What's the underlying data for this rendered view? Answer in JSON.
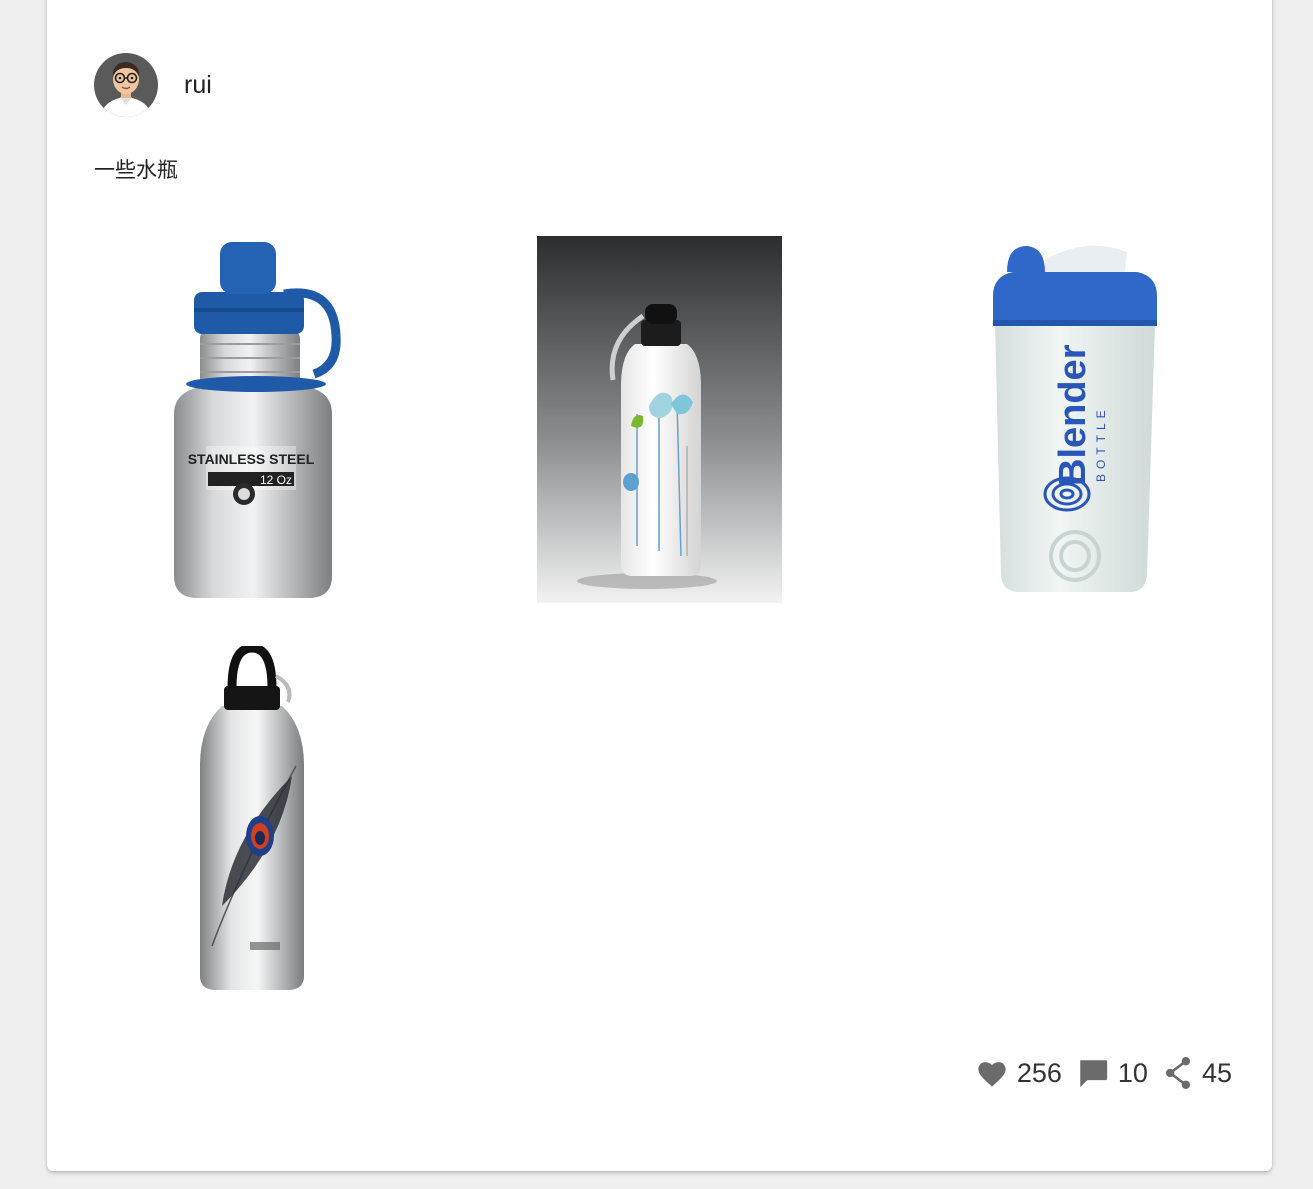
{
  "post": {
    "author": {
      "name": "rui",
      "avatar_icon": "cartoon-avatar-glasses"
    },
    "text": "一些水瓶",
    "images": [
      {
        "name": "stainless-steel-bottle",
        "label_line1": "STAINLESS STEEL",
        "label_line2": "12 Oz"
      },
      {
        "name": "white-floral-bottle"
      },
      {
        "name": "blender-shaker-bottle",
        "brand": "Blender",
        "brand_sub": "BOTTLE"
      },
      {
        "name": "peacock-feather-bottle"
      }
    ],
    "stats": {
      "likes": "256",
      "comments": "10",
      "shares": "45"
    },
    "colors": {
      "icon": "#6b6b6b",
      "accent_blue": "#2a56b8"
    }
  }
}
